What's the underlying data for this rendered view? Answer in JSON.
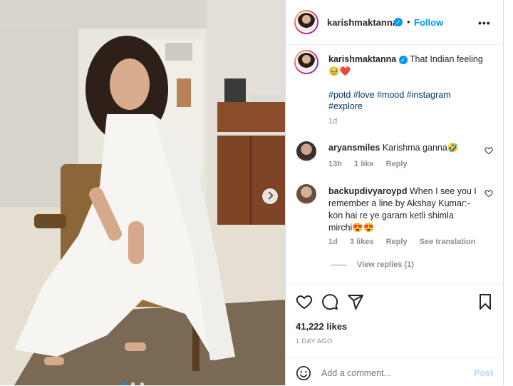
{
  "post": {
    "username": "karishmaktanna",
    "follow_label": "Follow",
    "caption_text": "That Indian feeling",
    "caption_emojis": "🥹❤️",
    "hashtags_line1": "#potd #love #mood #instagram",
    "hashtags_line2": "#explore",
    "age": "1d",
    "likes": "41,222 likes",
    "posted_ago": "1 DAY AGO"
  },
  "comments": [
    {
      "username": "aryansmiles",
      "text": "Karishma ganna🤣",
      "age": "13h",
      "likes": "1 like",
      "reply": "Reply"
    },
    {
      "username": "backupdivyaroypd",
      "text_line1": "When I see you I",
      "text_line2": "remember a line by Akshay Kumar:-",
      "text_line3": "kon hai re ye garam ketli shimla",
      "text_line4": "mirchi😍😍",
      "age": "1d",
      "likes": "3 likes",
      "reply": "Reply",
      "translate": "See translation",
      "view_replies": "View replies (1)"
    }
  ],
  "composer": {
    "placeholder": "Add a comment...",
    "post_label": "Post"
  },
  "icons": {
    "more": "more-options-icon",
    "like": "heart-icon",
    "comment": "comment-icon",
    "share": "share-icon",
    "save": "bookmark-icon",
    "emoji": "emoji-icon",
    "next": "chevron-right-icon"
  },
  "colors": {
    "accent": "#0095f6",
    "text": "#262626",
    "muted": "#8e8e8e",
    "hashtag": "#00376b"
  },
  "carousel": {
    "slides": 3,
    "active_index": 0
  }
}
